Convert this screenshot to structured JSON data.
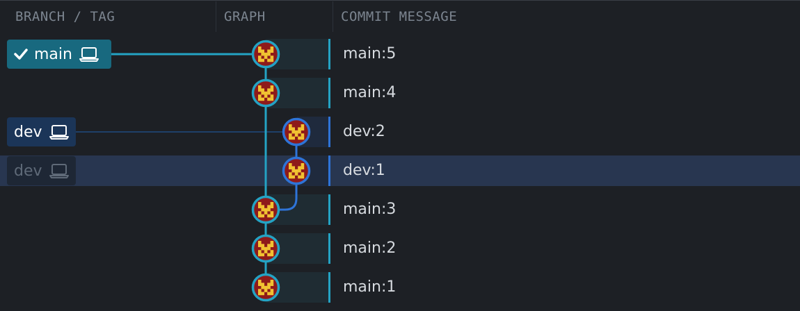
{
  "header": {
    "branch_col": "BRANCH / TAG",
    "graph_col": "GRAPH",
    "message_col": "COMMIT MESSAGE"
  },
  "branches": {
    "main": {
      "label": "main",
      "checked_out": true,
      "icons": [
        "check-icon",
        "laptop-icon"
      ]
    },
    "dev": {
      "label": "dev",
      "icons": [
        "laptop-icon"
      ]
    },
    "dev_ghost": {
      "label": "dev",
      "icons": [
        "laptop-icon"
      ]
    }
  },
  "commits": [
    {
      "message": "main:5",
      "lane": "main"
    },
    {
      "message": "main:4",
      "lane": "main"
    },
    {
      "message": "dev:2",
      "lane": "dev"
    },
    {
      "message": "dev:1",
      "lane": "dev",
      "selected": true
    },
    {
      "message": "main:3",
      "lane": "main"
    },
    {
      "message": "main:2",
      "lane": "main"
    },
    {
      "message": "main:1",
      "lane": "main"
    }
  ],
  "colors": {
    "main_lane": "#24a3c4",
    "dev_lane": "#2e74d8",
    "selected_row": "#283650",
    "avatar_bg": "#8e1a1a",
    "avatar_fg": "#f1c232"
  }
}
